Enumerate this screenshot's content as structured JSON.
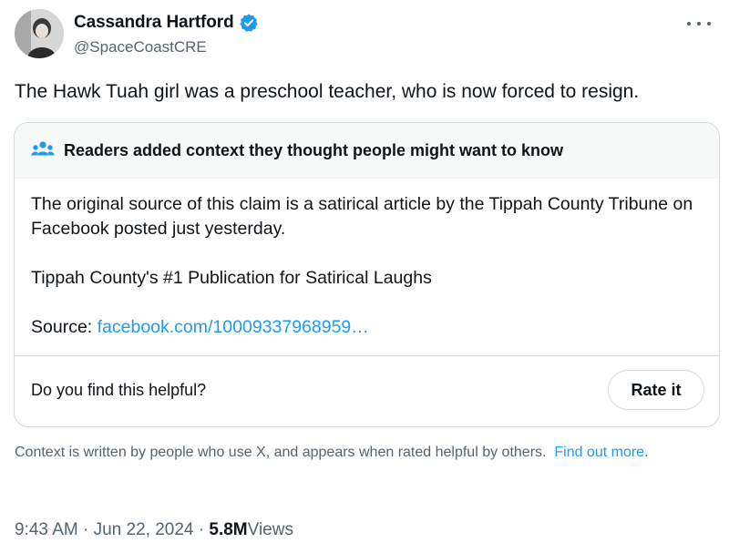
{
  "author": {
    "name": "Cassandra Hartford",
    "handle": "@SpaceCoastCRE"
  },
  "tweet": {
    "text": "The Hawk Tuah girl was a preschool teacher, who is now forced to resign."
  },
  "community_note": {
    "title": "Readers added context they thought people might want to know",
    "paragraph1": "The original source of this claim is a satirical article by the Tippah County Tribune on Facebook posted just yesterday.",
    "paragraph2": "Tippah County's #1 Publication for Satirical Laughs",
    "source_label": "Source:",
    "source_link": "facebook.com/10009337968959…",
    "helpful_question": "Do you find this helpful?",
    "rate_button": "Rate it"
  },
  "context_info": {
    "text": "Context is written by people who use X, and appears when rated helpful by others.",
    "link": "Find out more",
    "period": "."
  },
  "meta": {
    "time": "9:43 AM",
    "separator1": "·",
    "date": "Jun 22, 2024",
    "separator2": "·",
    "views_count": "5.8M",
    "views_label": "Views"
  },
  "icons": {
    "verified": "verified-badge-icon",
    "more": "more-icon",
    "people": "people-icon"
  },
  "colors": {
    "accent": "#1d9bf0",
    "text_primary": "#0f1419",
    "text_secondary": "#536471",
    "border": "#cfd9de",
    "note_header_bg": "#f7f9f9"
  }
}
